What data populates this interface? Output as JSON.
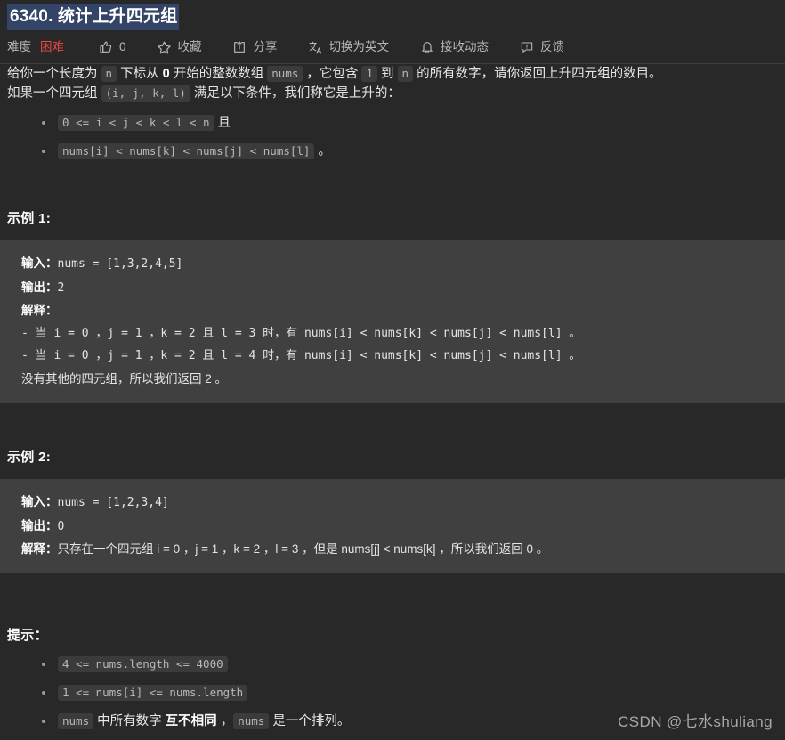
{
  "header": {
    "title": "6340. 统计上升四元组",
    "difficulty_label": "难度",
    "difficulty_value": "困难",
    "like_count": "0",
    "favorite_label": "收藏",
    "share_label": "分享",
    "translate_label": "切换为英文",
    "subscribe_label": "接收动态",
    "feedback_label": "反馈",
    "accent_red": "#ef4743",
    "selection_blue": "#334466"
  },
  "description": {
    "p1_a": "给你一个长度为 ",
    "p1_code_n1": "n",
    "p1_b": " 下标从 ",
    "p1_bold0": "0",
    "p1_c": " 开始的整数数组 ",
    "p1_code_nums": "nums",
    "p1_d": " ，它包含 ",
    "p1_code_1": "1",
    "p1_e": " 到 ",
    "p1_code_n2": "n",
    "p1_f": " 的所有数字，请你返回上升四元组的数目。",
    "p2_a": "如果一个四元组 ",
    "p2_code_tuple": "(i, j, k, l)",
    "p2_b": " 满足以下条件，我们称它是上升的：",
    "cond1_code": "0 <= i < j < k < l < n",
    "cond1_tail": " 且",
    "cond2_code": "nums[i] < nums[k] < nums[j] < nums[l]",
    "cond2_tail": " 。"
  },
  "example1": {
    "heading": "示例 1:",
    "input_label": "输入：",
    "input_value": "nums = [1,3,2,4,5]",
    "output_label": "输出：",
    "output_value": "2",
    "explain_label": "解释：",
    "explain_lines": [
      "- 当 i = 0 ，j = 1 ，k = 2 且 l = 3 时，有 nums[i] < nums[k] < nums[j] < nums[l] 。",
      "- 当 i = 0 ，j = 1 ，k = 2 且 l = 4 时，有 nums[i] < nums[k] < nums[j] < nums[l] 。",
      "没有其他的四元组，所以我们返回 2 。"
    ]
  },
  "example2": {
    "heading": "示例 2:",
    "input_label": "输入：",
    "input_value": "nums = [1,2,3,4]",
    "output_label": "输出：",
    "output_value": "0",
    "explain_label": "解释：",
    "explain_value": "只存在一个四元组 i = 0 ，j = 1 ，k = 2 ，l = 3 ，但是 nums[j] < nums[k] ，所以我们返回 0 。"
  },
  "hints": {
    "heading": "提示：",
    "item1_code": "4 <= nums.length <= 4000",
    "item2_code": "1 <= nums[i] <= nums.length",
    "item3_code_a": "nums",
    "item3_text_a": " 中所有数字 ",
    "item3_bold": "互不相同",
    "item3_text_b": " ，",
    "item3_code_b": "nums",
    "item3_text_c": " 是一个排列。"
  },
  "watermark": {
    "text": "CSDN @七水shuliang"
  }
}
